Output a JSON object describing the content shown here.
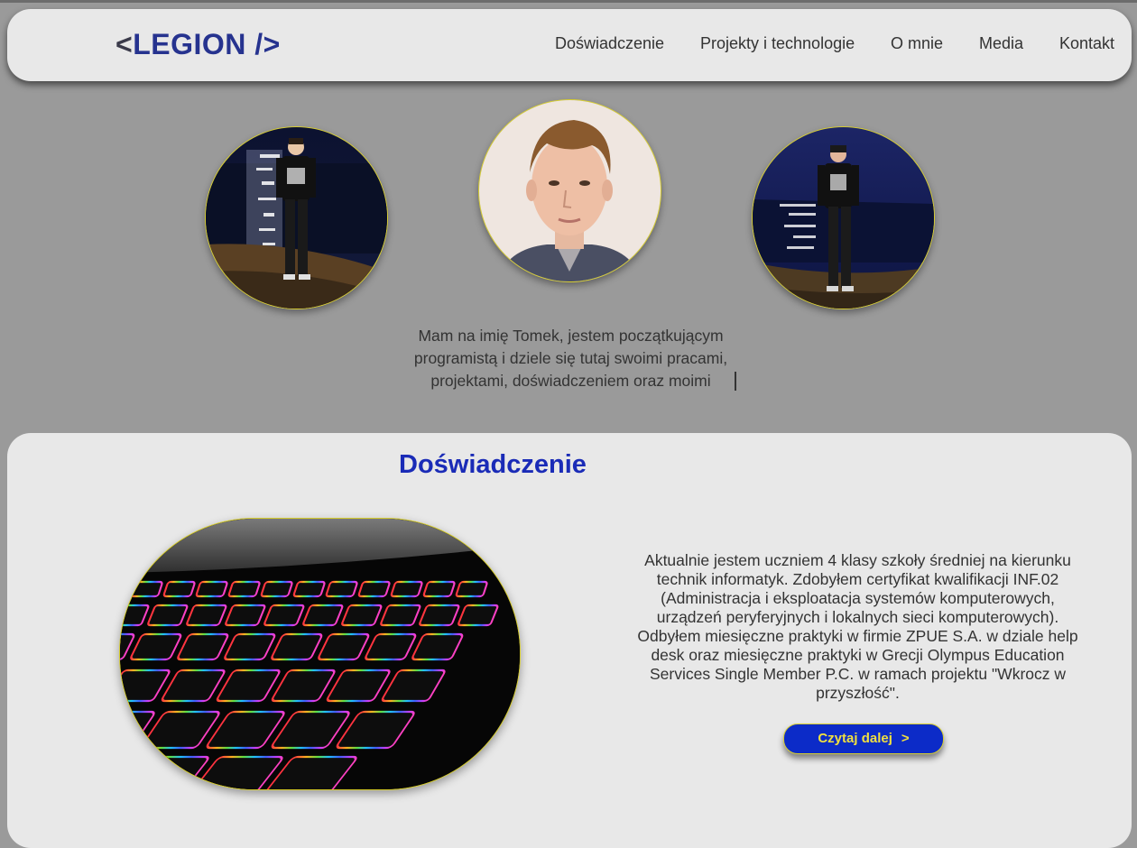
{
  "brand": {
    "open": "<",
    "name": "LEGION",
    "close": " />"
  },
  "nav": {
    "items": [
      {
        "label": "Doświadczenie"
      },
      {
        "label": "Projekty i technologie"
      },
      {
        "label": "O mnie"
      },
      {
        "label": "Media"
      },
      {
        "label": "Kontakt"
      }
    ]
  },
  "hero": {
    "intro_lines": [
      "Mam na imię Tomek, jestem początkującym",
      "programistą i dziele się tutaj swoimi pracami,",
      "projektami, doświadczeniem oraz moimi"
    ]
  },
  "experience": {
    "title": "Doświadczenie",
    "description_lines": [
      "Aktualnie jestem uczniem 4 klasy szkoły średniej na kierunku",
      "technik informatyk. Zdobyłem certyfikat kwalifikacji INF.02",
      "(Administracja i eksploatacja systemów komputerowych,",
      "urządzeń peryferyjnych i lokalnych sieci komputerowych).",
      "Odbyłem miesięczne praktyki w firmie ZPUE S.A. w dziale help",
      "desk oraz miesięczne praktyki w Grecji Olympus Education",
      "Services Single Member P.C. w ramach projektu \"Wkrocz w",
      "przyszłość\"."
    ],
    "button_label": "Czytaj dalej",
    "button_arrow": ">"
  },
  "colors": {
    "page_bg": "#9a9a9a",
    "card_bg": "#e8e8e8",
    "accent_blue": "#1a2bb7",
    "button_blue": "#0c2bc8",
    "button_text": "#f0e040",
    "border_yellow": "#d9cf2b"
  }
}
